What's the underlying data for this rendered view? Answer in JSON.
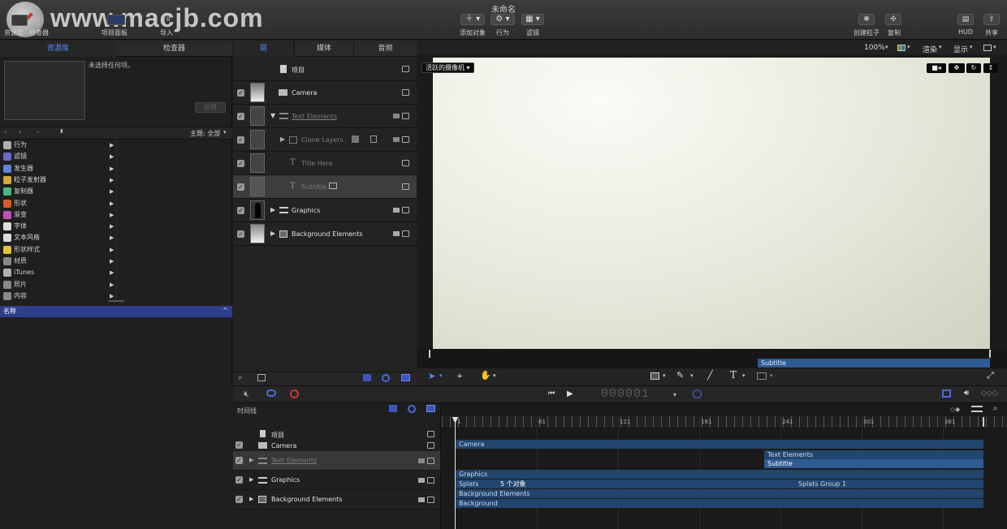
{
  "window_title": "未命名",
  "watermark": "www.macjb.com",
  "toolbar": {
    "left": [
      "资源库",
      "检查器",
      "项目面板",
      "导入"
    ],
    "center": [
      {
        "icon": "add-object-icon",
        "label": "添加对象"
      },
      {
        "icon": "behaviors-icon",
        "label": "行为"
      },
      {
        "icon": "filters-icon",
        "label": "滤镜"
      }
    ],
    "right": [
      {
        "icon": "particles-icon",
        "label": "创建粒子"
      },
      {
        "icon": "replicate-icon",
        "label": "复制"
      },
      {
        "icon": "hud-icon",
        "label": "HUD"
      },
      {
        "icon": "share-icon",
        "label": "共享"
      }
    ]
  },
  "left_panel": {
    "tabs": [
      "资源库",
      "检查器"
    ],
    "active_tab": "资源库",
    "preview_text": "未选择任何项。",
    "apply_button": "应用",
    "nav_select": "-",
    "theme_label": "主题: 全部",
    "categories": [
      {
        "label": "行为",
        "icon": "gear-icon",
        "color": "#b0b0b0"
      },
      {
        "label": "滤镜",
        "icon": "filter-icon",
        "color": "#6a6ac8"
      },
      {
        "label": "发生器",
        "icon": "generator-icon",
        "color": "#5c86d8"
      },
      {
        "label": "粒子发射器",
        "icon": "emitter-icon",
        "color": "#d8a93a"
      },
      {
        "label": "复制器",
        "icon": "replicator-icon",
        "color": "#4ab884"
      },
      {
        "label": "形状",
        "icon": "shape-icon",
        "color": "#d85a2c"
      },
      {
        "label": "渐变",
        "icon": "gradient-icon",
        "color": "#c050b8"
      },
      {
        "label": "字体",
        "icon": "font-icon",
        "color": "#dddddd"
      },
      {
        "label": "文本风格",
        "icon": "text-style-icon",
        "color": "#dddddd"
      },
      {
        "label": "形状样式",
        "icon": "shape-style-icon",
        "color": "#e6c23a"
      },
      {
        "label": "材质",
        "icon": "material-icon",
        "color": "#888888"
      },
      {
        "label": "iTunes",
        "icon": "itunes-icon",
        "color": "#b0b0b0"
      },
      {
        "label": "照片",
        "icon": "photos-icon",
        "color": "#888888"
      },
      {
        "label": "内容",
        "icon": "content-icon",
        "color": "#888888"
      }
    ],
    "name_header": "名称"
  },
  "layers_panel": {
    "tabs": [
      "层",
      "媒体",
      "音频"
    ],
    "active_tab": "层",
    "rows": [
      {
        "name": "项目",
        "dim": false
      },
      {
        "name": "Camera",
        "dim": false
      },
      {
        "name": "Text Elements",
        "dim": true
      },
      {
        "name": "Clone Layers",
        "dim": true
      },
      {
        "name": "Title Here",
        "dim": true
      },
      {
        "name": "Subtitle",
        "dim": true
      },
      {
        "name": "Graphics",
        "dim": false
      },
      {
        "name": "Background Elements",
        "dim": false
      }
    ]
  },
  "canvas": {
    "zoom": "100%",
    "render_menu": "渲染",
    "view_menu": "显示",
    "camera_menu": "活跃的摄像机",
    "mini_track_label": "Subtitle"
  },
  "transport": {
    "timecode": "000001"
  },
  "timeline": {
    "header": "时间线",
    "ruler": [
      "1",
      "61",
      "121",
      "181",
      "241",
      "301",
      "361"
    ],
    "rows": [
      {
        "name": "项目",
        "dim": false
      },
      {
        "name": "Camera",
        "dim": false
      },
      {
        "name": "Text Elements",
        "dim": true
      },
      {
        "name": "Graphics",
        "dim": false
      },
      {
        "name": "Background Elements",
        "dim": false
      }
    ],
    "tracks": {
      "camera": "Camera",
      "text_elements": "Text Elements",
      "subtitle": "Subtitle",
      "graphics": "Graphics",
      "splats": "Splats",
      "object_count": "5 个对象",
      "splats_group": "Splats Group 1",
      "background_elements": "Background Elements",
      "background": "Background"
    }
  }
}
